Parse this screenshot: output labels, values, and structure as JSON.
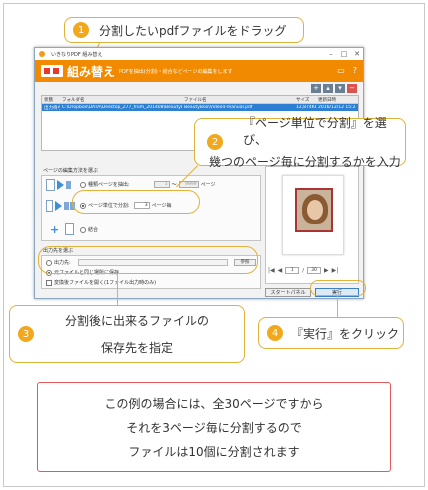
{
  "callouts": {
    "c1": {
      "num": "1",
      "text": "分割したいpdfファイルをドラッグ"
    },
    "c2": {
      "num": "2",
      "line1": "『ページ単位で分割』を選び、",
      "line2": "幾つのページ毎に分割するかを入力"
    },
    "c3": {
      "num": "3",
      "line1": "分割後に出来るファイルの",
      "line2": "保存先を指定"
    },
    "c4": {
      "num": "4",
      "text": "『実行』をクリック"
    }
  },
  "app": {
    "window_title": "いきなりPDF  組み替え",
    "app_name": "組み替え",
    "subtitle": "PDFを抽出(分割)・結合などページの編集をします",
    "table": {
      "headers": [
        "状態",
        "フォルダ名",
        "ファイル名",
        "サイズ",
        "更新日時"
      ],
      "rows": [
        [
          "出力待ち",
          "C:\\Dropbox\\DATA\\Desktop_Z77_from_201408\\BeautyB...",
          "BeautyBox\\Video4-manual.pdf",
          "12,874KB",
          "2016/12/12 15:2"
        ]
      ]
    },
    "split_section_label": "ページの編集方法を選ぶ",
    "opt_extract": "種類ページを抽出:",
    "extract_from": "1",
    "extract_tilde": "〜",
    "extract_to": "9999",
    "extract_unit": "ページ",
    "opt_split": "ページ単位で分割:",
    "split_value": "3",
    "split_unit": "ページ毎",
    "opt_merge": "結合",
    "output_section_label": "出力先を選ぶ",
    "opt_out_folder": "出力先:",
    "ref_button": "参照",
    "opt_same_folder": "元ファイルと同じ場所に保存",
    "open_after": "変換後ファイルを開く(1ファイル出力時のみ)",
    "page_current": "1",
    "page_sep": "/",
    "page_total": "30",
    "start_panel_button": "スタートパネル",
    "run_button": "実行"
  },
  "note": {
    "line1": "この例の場合には、全30ページですから",
    "line2": "それを3ページ毎に分割するので",
    "line3": "ファイルは10個に分割されます"
  },
  "colors": {
    "accent_orange": "#f28a00",
    "callout_border": "#e0b23a",
    "note_border": "#e05a5a",
    "selected_row": "#2d7fd1"
  }
}
